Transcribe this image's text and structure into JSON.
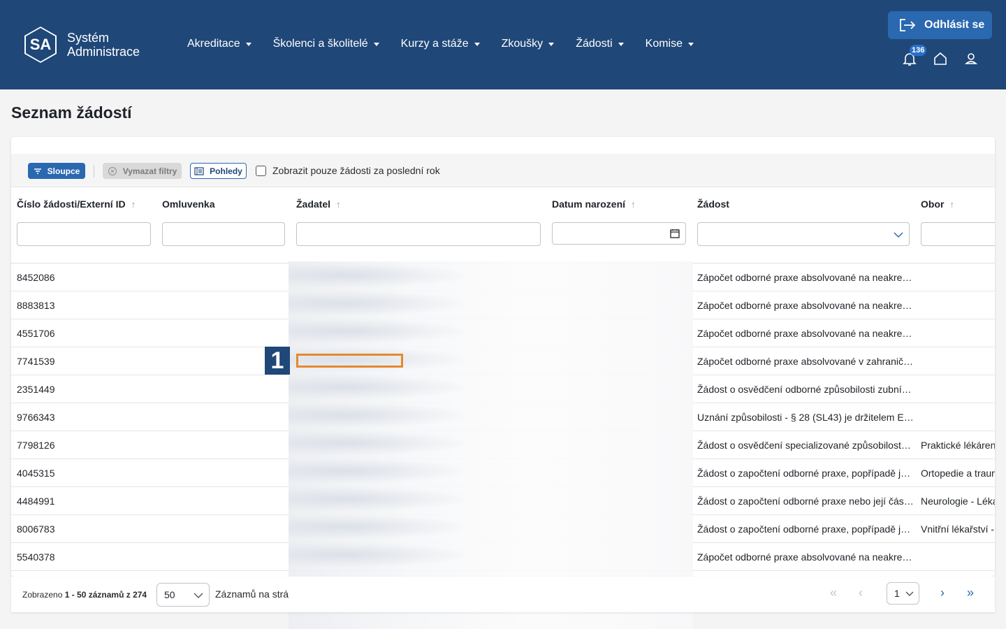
{
  "header": {
    "logo_text": "SA",
    "brand_line1": "Systém",
    "brand_line2": "Administrace",
    "nav": [
      "Akreditace",
      "Školenci a školitelé",
      "Kurzy a stáže",
      "Zkoušky",
      "Žádosti",
      "Komise"
    ],
    "logout_label": "Odhlásit se",
    "notifications_count": "136",
    "icons": [
      "logout-icon",
      "bell-icon",
      "home-icon",
      "user-icon"
    ]
  },
  "page_title": "Seznam žádostí",
  "toolbar": {
    "columns_label": "Sloupce",
    "clear_filters_label": "Vymazat filtry",
    "views_label": "Pohledy",
    "last_year_label": "Zobrazit pouze žádosti za poslední rok",
    "last_year_checked": false
  },
  "columns": {
    "id": "Číslo žádosti/Externí ID",
    "excuse": "Omluvenka",
    "applicant": "Žadatel",
    "birthdate": "Datum narození",
    "request": "Žádost",
    "field": "Obor"
  },
  "rows": [
    {
      "id": "8452086",
      "request": "Zápočet odborné praxe absolvované na neakre…",
      "field": ""
    },
    {
      "id": "8883813",
      "request": "Zápočet odborné praxe absolvované na neakre…",
      "field": ""
    },
    {
      "id": "4551706",
      "request": "Zápočet odborné praxe absolvované na neakre…",
      "field": ""
    },
    {
      "id": "7741539",
      "request": "Zápočet odborné praxe absolvované v zahranič…",
      "field": ""
    },
    {
      "id": "2351449",
      "request": "Žádost o osvědčení odborné způsobilosti zubní…",
      "field": ""
    },
    {
      "id": "9766343",
      "request": "Uznání způsobilosti - § 28 (SL43) je držitelem E…",
      "field": ""
    },
    {
      "id": "7798126",
      "request": "Žádost o osvědčení specializované způsobilost…",
      "field": "Praktické lékáren"
    },
    {
      "id": "4045315",
      "request": "Žádost o započtení odborné praxe, popřípadě j…",
      "field": "Ortopedie a traum"
    },
    {
      "id": "4484991",
      "request": "Žádost o započtení odborné praxe nebo její čás…",
      "field": "Neurologie - Léka"
    },
    {
      "id": "8006783",
      "request": "Žádost o započtení odborné praxe, popřípadě j…",
      "field": "Vnitřní lékařství -"
    },
    {
      "id": "5540378",
      "request": "Zápočet odborné praxe absolvované na neakre…",
      "field": ""
    }
  ],
  "marker_label": "1",
  "footer": {
    "shown_prefix": "Zobrazeno ",
    "shown_range": "1 - 50 záznamů z 274",
    "page_size": "50",
    "page_size_label": "Záznamů na strá",
    "current_page": "1"
  }
}
